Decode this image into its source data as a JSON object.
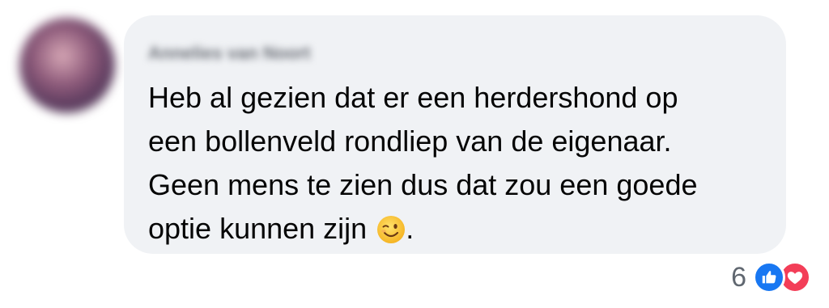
{
  "comment": {
    "author": "Annelies van Noort",
    "text": "Heb al gezien dat er een herdershond op\neen bollenveld rondliep van de eigenaar.\nGeen mens te zien dus dat zou een goede\noptie kunnen zijn",
    "emoji": "winking-face-emoji",
    "trailing": "."
  },
  "reactions": {
    "count": "6",
    "types": [
      "like-icon",
      "love-icon"
    ]
  },
  "colors": {
    "bubble": "#f0f2f5",
    "text": "#050505",
    "like": "#1877f2",
    "love": "#f33e58"
  }
}
